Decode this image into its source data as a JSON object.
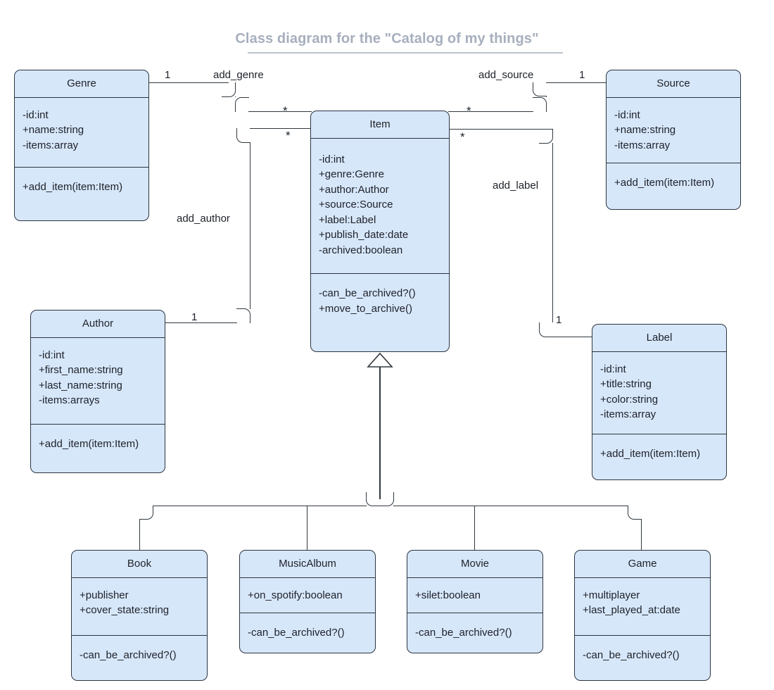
{
  "title": {
    "text": "Class diagram for the \"Catalog of my things\"",
    "color": "#a7afbd",
    "underline_color": "#bcc3ce"
  },
  "theme": {
    "box_fill": "#d7e7fa",
    "box_border": "#2b3440",
    "line_color": "#30383f",
    "text_color": "#1d2129",
    "background": "#ffffff"
  },
  "classes": {
    "genre": {
      "name": "Genre",
      "attributes": [
        "-id:int",
        "+name:string",
        "-items:array"
      ],
      "methods": [
        "+add_item(item:Item)"
      ]
    },
    "item": {
      "name": "Item",
      "attributes": [
        "-id:int",
        "+genre:Genre",
        "+author:Author",
        "+source:Source",
        "+label:Label",
        "+publish_date:date",
        "-archived:boolean"
      ],
      "methods": [
        "-can_be_archived?()",
        "+move_to_archive()"
      ]
    },
    "source": {
      "name": "Source",
      "attributes": [
        "-id:int",
        "+name:string",
        "-items:array"
      ],
      "methods": [
        "+add_item(item:Item)"
      ]
    },
    "author": {
      "name": "Author",
      "attributes": [
        "-id:int",
        "+first_name:string",
        "+last_name:string",
        "-items:arrays"
      ],
      "methods": [
        "+add_item(item:Item)"
      ]
    },
    "label": {
      "name": "Label",
      "attributes": [
        "-id:int",
        "+title:string",
        "+color:string",
        "-items:array"
      ],
      "methods": [
        "+add_item(item:Item)"
      ]
    },
    "book": {
      "name": "Book",
      "attributes": [
        "+publisher",
        "+cover_state:string"
      ],
      "methods": [
        "-can_be_archived?()"
      ]
    },
    "music_album": {
      "name": "MusicAlbum",
      "attributes": [
        "+on_spotify:boolean"
      ],
      "methods": [
        "-can_be_archived?()"
      ]
    },
    "movie": {
      "name": "Movie",
      "attributes": [
        "+silet:boolean"
      ],
      "methods": [
        "-can_be_archived?()"
      ]
    },
    "game": {
      "name": "Game",
      "attributes": [
        "+multiplayer",
        "+last_played_at:date"
      ],
      "methods": [
        "-can_be_archived?()"
      ]
    }
  },
  "relationships": {
    "add_genre": {
      "label": "add_genre",
      "from": "Genre",
      "to": "Item",
      "source_multiplicity": "1",
      "target_multiplicity": "*"
    },
    "add_author": {
      "label": "add_author",
      "from": "Author",
      "to": "Item",
      "source_multiplicity": "1",
      "target_multiplicity": "*"
    },
    "add_source": {
      "label": "add_source",
      "from": "Item",
      "to": "Source",
      "source_multiplicity": "*",
      "target_multiplicity": "1"
    },
    "add_label": {
      "label": "add_label",
      "from": "Item",
      "to": "Label",
      "source_multiplicity": "*",
      "target_multiplicity": "1"
    },
    "inheritance": {
      "parent": "Item",
      "children": [
        "Book",
        "MusicAlbum",
        "Movie",
        "Game"
      ],
      "arrow_type": "hollow-triangle"
    }
  }
}
